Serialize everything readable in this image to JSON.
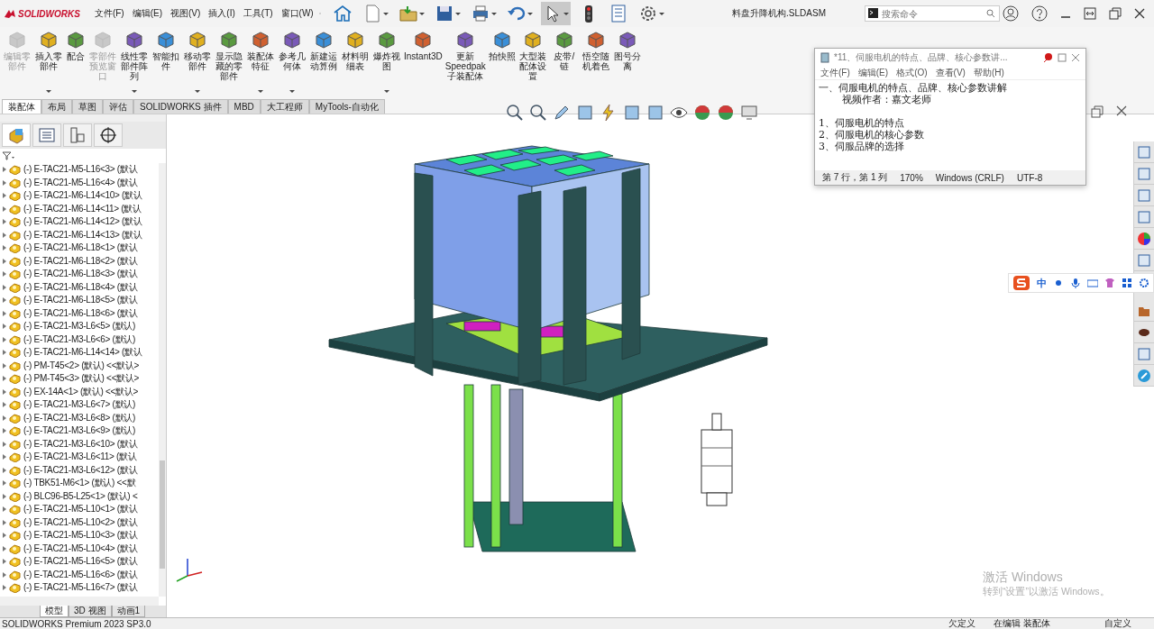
{
  "title_bar": {
    "logo": "SOLIDWORKS",
    "menus": [
      "文件(F)",
      "编辑(E)",
      "视图(V)",
      "插入(I)",
      "工具(T)",
      "窗口(W)"
    ],
    "title": "料盘升降机构.SLDASM",
    "search": {
      "placeholder": "搜索命令"
    }
  },
  "ribbon": {
    "buttons": [
      {
        "label": "编辑零部件",
        "disabled": true,
        "dropdown": false
      },
      {
        "label": "插入零部件",
        "disabled": false,
        "dropdown": true
      },
      {
        "label": "配合",
        "disabled": false,
        "dropdown": false
      },
      {
        "label": "零部件预览窗口",
        "disabled": true,
        "dropdown": false
      },
      {
        "label": "线性零部件阵列",
        "disabled": false,
        "dropdown": true
      },
      {
        "label": "智能扣件",
        "disabled": false,
        "dropdown": false
      },
      {
        "label": "移动零部件",
        "disabled": false,
        "dropdown": true
      },
      {
        "label": "显示隐藏的零部件",
        "disabled": false,
        "dropdown": false
      },
      {
        "label": "装配体特征",
        "disabled": false,
        "dropdown": true
      },
      {
        "label": "参考几何体",
        "disabled": false,
        "dropdown": true
      },
      {
        "label": "新建运动算例",
        "disabled": false,
        "dropdown": false
      },
      {
        "label": "材料明细表",
        "disabled": false,
        "dropdown": false
      },
      {
        "label": "爆炸视图",
        "disabled": false,
        "dropdown": true
      },
      {
        "label": "Instant3D",
        "disabled": false,
        "dropdown": false
      },
      {
        "label": "更新Speedpak子装配体",
        "disabled": false,
        "dropdown": false
      },
      {
        "label": "拍快照",
        "disabled": false,
        "dropdown": false
      },
      {
        "label": "大型装配体设置",
        "disabled": false,
        "dropdown": false
      },
      {
        "label": "皮带/链",
        "disabled": false,
        "dropdown": false
      },
      {
        "label": "悟空随机着色",
        "disabled": false,
        "dropdown": false
      },
      {
        "label": "图号分离",
        "disabled": false,
        "dropdown": false
      }
    ]
  },
  "command_tabs": [
    {
      "label": "装配体",
      "selected": true
    },
    {
      "label": "布局",
      "selected": false
    },
    {
      "label": "草图",
      "selected": false
    },
    {
      "label": "评估",
      "selected": false
    },
    {
      "label": "SOLIDWORKS 插件",
      "selected": false
    },
    {
      "label": "MBD",
      "selected": false
    },
    {
      "label": "大工程师",
      "selected": false
    },
    {
      "label": "MyTools-自动化",
      "selected": false
    }
  ],
  "feature_tree": {
    "items": [
      "(-) E-TAC21-M5-L16<3> (默认",
      "(-) E-TAC21-M5-L16<4> (默认",
      "(-) E-TAC21-M6-L14<10> (默认",
      "(-) E-TAC21-M6-L14<11> (默认",
      "(-) E-TAC21-M6-L14<12> (默认",
      "(-) E-TAC21-M6-L14<13> (默认",
      "(-) E-TAC21-M6-L18<1> (默认",
      "(-) E-TAC21-M6-L18<2> (默认",
      "(-) E-TAC21-M6-L18<3> (默认",
      "(-) E-TAC21-M6-L18<4> (默认",
      "(-) E-TAC21-M6-L18<5> (默认",
      "(-) E-TAC21-M6-L18<6> (默认",
      "(-) E-TAC21-M3-L6<5> (默认)",
      "(-) E-TAC21-M3-L6<6> (默认)",
      "(-) E-TAC21-M6-L14<14> (默认",
      "(-) PM-T45<2> (默认) <<默认>",
      "(-) PM-T45<3> (默认) <<默认>",
      "(-) EX-14A<1> (默认) <<默认>",
      "(-) E-TAC21-M3-L6<7> (默认)",
      "(-) E-TAC21-M3-L6<8> (默认)",
      "(-) E-TAC21-M3-L6<9> (默认)",
      "(-) E-TAC21-M3-L6<10> (默认",
      "(-) E-TAC21-M3-L6<11> (默认",
      "(-) E-TAC21-M3-L6<12> (默认",
      "(-) TBK51-M6<1> (默认) <<默",
      "(-) BLC96-B5-L25<1> (默认) <",
      "(-) E-TAC21-M5-L10<1> (默认",
      "(-) E-TAC21-M5-L10<2> (默认",
      "(-) E-TAC21-M5-L10<3> (默认",
      "(-) E-TAC21-M5-L10<4> (默认",
      "(-) E-TAC21-M5-L16<5> (默认",
      "(-) E-TAC21-M5-L16<6> (默认",
      "(-) E-TAC21-M5-L16<7> (默认"
    ]
  },
  "bottom_tabs": [
    {
      "label": "模型",
      "selected": true
    },
    {
      "label": "3D 视图",
      "selected": false
    },
    {
      "label": "动画1",
      "selected": false
    }
  ],
  "notepad": {
    "title": "*11、伺服电机的特点、品牌、核心参数讲...",
    "menus": [
      "文件(F)",
      "编辑(E)",
      "格式(O)",
      "查看(V)",
      "帮助(H)"
    ],
    "heading": [
      "一、伺服电机的特点、品牌、核心参数讲解",
      "视频作者：嘉文老师"
    ],
    "list": [
      "1、伺服电机的特点",
      "2、伺服电机的核心参数",
      "3、伺服品牌的选择"
    ],
    "status": [
      "第 7 行，第 1 列",
      "170%",
      "Windows (CRLF)",
      "UTF-8"
    ]
  },
  "ime_bar": {
    "label": "中"
  },
  "activation_notice": {
    "title": "激活 Windows",
    "subtitle": "转到“设置”以激活 Windows。"
  },
  "status_bar": {
    "product": "SOLIDWORKS Premium 2023 SP3.0",
    "items": [
      "欠定义",
      "在编辑 装配体",
      "自定义"
    ]
  }
}
